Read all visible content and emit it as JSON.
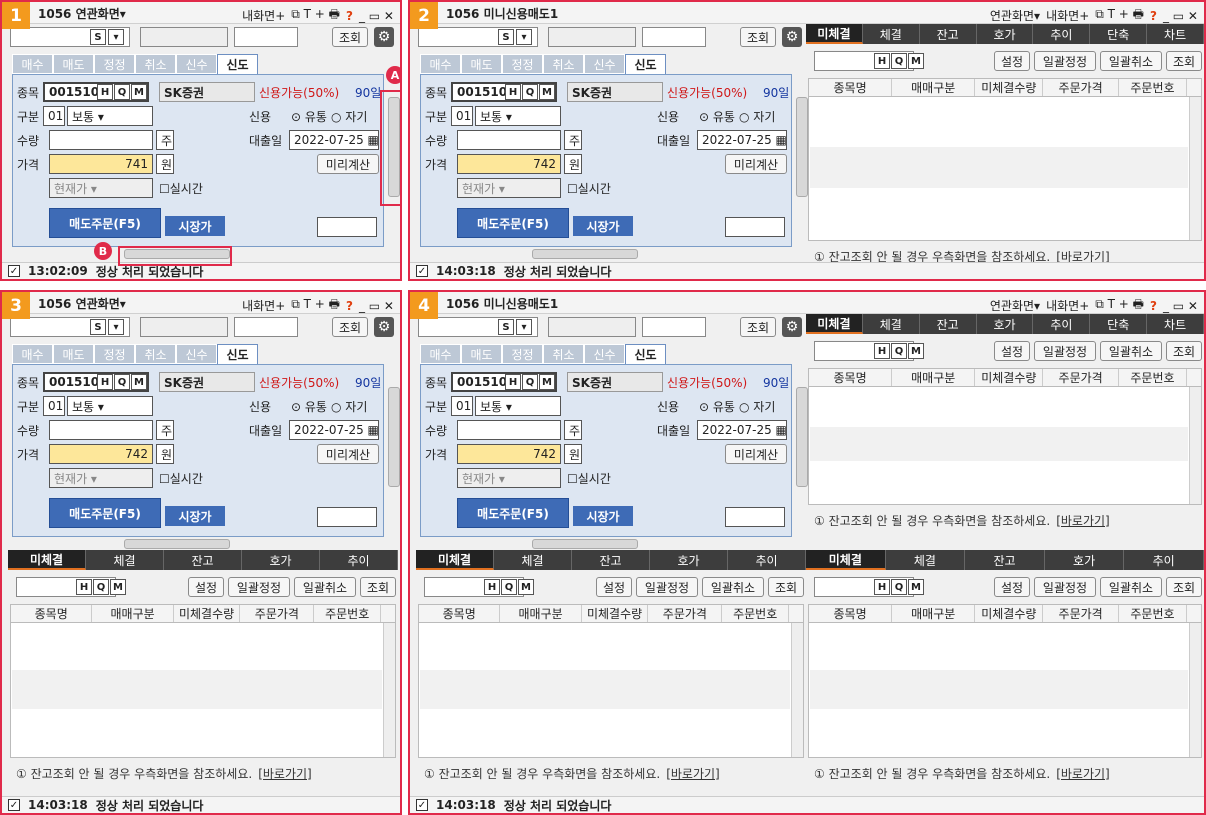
{
  "panels": [
    {
      "number": "1",
      "title": "1056 연관화면▾",
      "status_time": "13:02:09",
      "status_text": "정상 처리 되었습니다",
      "price": "741",
      "markerA": "A",
      "markerB": "B"
    },
    {
      "number": "2",
      "title": "1056 미니신용매도1",
      "status_time": "14:03:18",
      "status_text": "정상 처리 되었습니다",
      "price": "742"
    },
    {
      "number": "3",
      "title": "1056 연관화면▾",
      "status_time": "14:03:18",
      "status_text": "정상 처리 되었습니다",
      "price": "742"
    },
    {
      "number": "4",
      "title": "1056 미니신용매도1",
      "status_time": "14:03:18",
      "status_text": "정상 처리 되었습니다",
      "price": "742"
    }
  ],
  "titlebar": {
    "related": "연관화면▾",
    "my_screen": "내화면+",
    "icons": "⧉ T + 🖶",
    "help": "?",
    "window": "_ ▭ ✕"
  },
  "query": {
    "s_label": "S",
    "search_label": "조회"
  },
  "order": {
    "tabs": [
      "매수",
      "매도",
      "정정",
      "취소",
      "신수",
      "신도"
    ],
    "stock_label": "종목",
    "stock_code": "001510",
    "btn_h": "H",
    "btn_q": "Q",
    "btn_m": "M",
    "stock_name": "SK증권",
    "credit_avail": "신용가능(50%)",
    "days": "90일",
    "type_label": "구분",
    "type_code": "01",
    "type_value": "보통",
    "credit_label": "신용",
    "radio_1": "유통",
    "radio_2": "자기",
    "qty_label": "수량",
    "qty_unit": "주",
    "loan_label": "대출일",
    "loan_date": "2022-07-25",
    "price_label": "가격",
    "price_unit": "원",
    "calc": "미리계산",
    "price_type": "현재가",
    "realtime": "실시간",
    "sell": "매도주문(F5)",
    "market": "시장가"
  },
  "side": {
    "tabs_full": [
      "미체결",
      "체결",
      "잔고",
      "호가",
      "추이",
      "단축",
      "차트"
    ],
    "tabs_short": [
      "미체결",
      "체결",
      "잔고",
      "호가",
      "추이"
    ],
    "setting": "설정",
    "bulk_edit": "일괄정정",
    "bulk_cancel": "일괄취소",
    "search": "조회",
    "columns": [
      "종목명",
      "매매구분",
      "미체결수량",
      "주문가격",
      "주문번호"
    ],
    "note": "① 잔고조회 안 될 경우 우측화면을 참조하세요.",
    "link": "[바로가기]"
  }
}
